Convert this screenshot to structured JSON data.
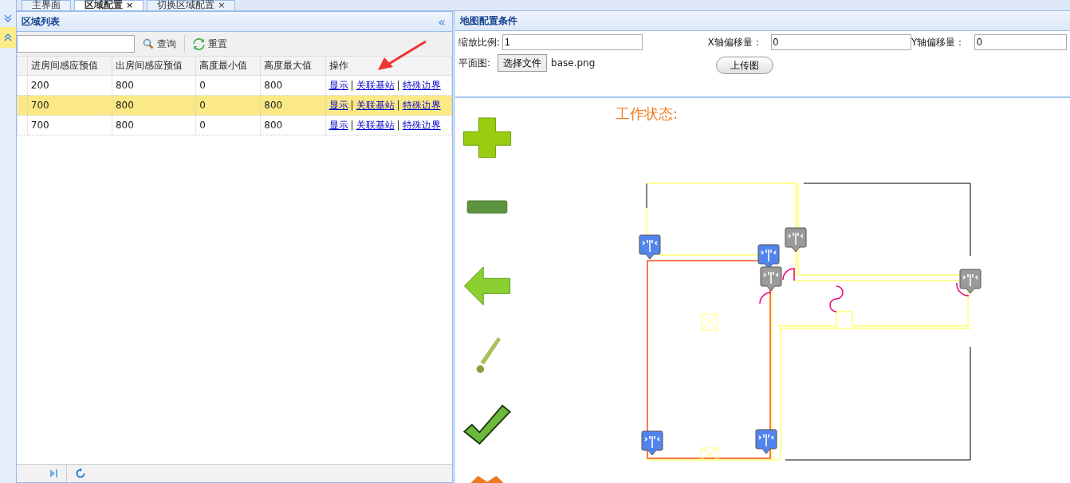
{
  "tabs": [
    {
      "label": "主界面",
      "selected": false
    },
    {
      "label": "区域配置",
      "close": "×",
      "selected": true
    },
    {
      "label": "切换区域配置",
      "close": "×",
      "selected": false
    }
  ],
  "left_panel": {
    "title": "区域列表",
    "collapse": "«",
    "search_button": "查询",
    "reset_button": "重置",
    "table": {
      "columns": [
        "进房间感应预值",
        "出房间感应预值",
        "高度最小值",
        "高度最大值",
        "操作"
      ],
      "rows": [
        {
          "selected": false,
          "cells": [
            "200",
            "800",
            "0",
            "800"
          ],
          "actions": [
            {
              "kind": "link",
              "text": "显示"
            },
            {
              "kind": "separator",
              "text": "|"
            },
            {
              "kind": "link",
              "text": "关联基站"
            },
            {
              "kind": "separator",
              "text": "|"
            },
            {
              "kind": "link",
              "text": "特殊边界"
            }
          ]
        },
        {
          "selected": true,
          "cells": [
            "700",
            "800",
            "0",
            "800"
          ],
          "actions": [
            {
              "kind": "link",
              "text": "显示"
            },
            {
              "kind": "separator",
              "text": "|"
            },
            {
              "kind": "link",
              "text": "关联基站"
            },
            {
              "kind": "separator",
              "text": "|"
            },
            {
              "kind": "link",
              "text": "特殊边界"
            }
          ]
        },
        {
          "selected": false,
          "cells": [
            "700",
            "800",
            "0",
            "800"
          ],
          "actions": [
            {
              "kind": "link",
              "text": "显示"
            },
            {
              "kind": "separator",
              "text": "|"
            },
            {
              "kind": "link",
              "text": "关联基站"
            },
            {
              "kind": "separator",
              "text": "|"
            },
            {
              "kind": "link",
              "text": "特殊边界"
            }
          ]
        }
      ]
    }
  },
  "right_panel": {
    "title": "地图配置条件",
    "fields": [
      {
        "label": "缩放比例:",
        "value": "1"
      },
      {
        "label": "X轴偏移量：",
        "value": "0"
      },
      {
        "label": "Y轴偏移量：",
        "value": "0"
      }
    ],
    "plan_label": "平面图:",
    "file_button": "选择文件",
    "file_name": "base.png",
    "upload_button": "上传图",
    "status_label": "工作状态:",
    "markers": [
      {
        "color": "#5284ee"
      },
      {
        "color": "#5284ee"
      },
      {
        "color": "#9a9a9a"
      },
      {
        "color": "#9a9a9a"
      },
      {
        "color": "#9a9a9a"
      },
      {
        "color": "#5284ee"
      },
      {
        "color": "#5284ee"
      }
    ]
  }
}
